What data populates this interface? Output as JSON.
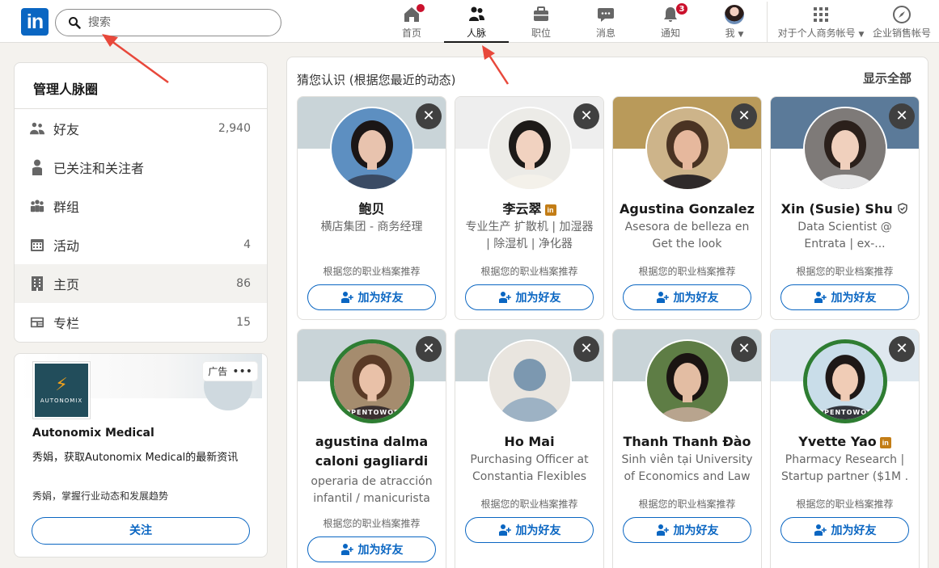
{
  "nav": {
    "logo_text": "in",
    "search": {
      "placeholder": "搜索"
    },
    "items": [
      {
        "label": "首页",
        "icon": "home-icon",
        "badge": ""
      },
      {
        "label": "人脉",
        "icon": "network-icon",
        "badge": ""
      },
      {
        "label": "职位",
        "icon": "briefcase-icon",
        "badge": ""
      },
      {
        "label": "消息",
        "icon": "messaging-icon",
        "badge": ""
      },
      {
        "label": "通知",
        "icon": "bell-icon",
        "badge": "3"
      },
      {
        "label": "我",
        "icon": "avatar",
        "badge": ""
      }
    ],
    "business": {
      "label": "对于个人商务帐号",
      "icon": "grid-icon"
    },
    "sales": {
      "label": "企业销售帐号",
      "icon": "compass-icon"
    }
  },
  "manage": {
    "title": "管理人脉圈",
    "items": [
      {
        "label": "好友",
        "count": "2,940",
        "icon": "people-icon"
      },
      {
        "label": "已关注和关注者",
        "count": "",
        "icon": "person-icon"
      },
      {
        "label": "群组",
        "count": "",
        "icon": "group-icon"
      },
      {
        "label": "活动",
        "count": "4",
        "icon": "calendar-icon"
      },
      {
        "label": "主页",
        "count": "86",
        "icon": "building-icon"
      },
      {
        "label": "专栏",
        "count": "15",
        "icon": "newsletter-icon"
      }
    ]
  },
  "ad": {
    "tag": "广告",
    "logo_text": "AUTONOMIX",
    "company": "Autonomix Medical",
    "desc": "秀娟，获取Autonomix Medical的最新资讯",
    "desc2": "秀娟，掌握行业动态和发展趋势",
    "follow": "关注"
  },
  "suggestions": {
    "title": "猜您认识 (根据您最近的动态)",
    "show_all": "显示全部",
    "reason": "根据您的职业档案推荐",
    "connect_label": "加为好友",
    "people": [
      {
        "name": "鲍贝",
        "headline": "横店集团 - 商务经理",
        "premium": false,
        "verified": false,
        "otw": false,
        "bg": "#c9d4d8",
        "skin": "#e8c3ae",
        "hair": "#1b1616",
        "shirt": "#3a4b64",
        "scene": "#5d8fc1"
      },
      {
        "name": "李云翠",
        "headline": "专业生产 扩散机 | 加湿器 | 除湿机 | 净化器",
        "premium": true,
        "verified": false,
        "otw": false,
        "bg": "#eeeeee",
        "skin": "#f1d2c0",
        "hair": "#1d1a18",
        "shirt": "#f4f1ea",
        "scene": "#ecebe7"
      },
      {
        "name": "Agustina Gonzalez",
        "headline": "Asesora de belleza en Get the look",
        "premium": false,
        "verified": false,
        "otw": false,
        "bg": "#b99a5a",
        "skin": "#e6b89d",
        "hair": "#4a3323",
        "shirt": "#2f2a2a",
        "scene": "#cdb48a"
      },
      {
        "name": "Xin (Susie) Shu",
        "headline": "Data Scientist @ Entrata | ex-...",
        "premium": false,
        "verified": true,
        "otw": false,
        "bg": "#5b7a99",
        "skin": "#f0d0bd",
        "hair": "#2b201b",
        "shirt": "#e9e9ea",
        "scene": "#7e7a78"
      },
      {
        "name": "agustina dalma caloni gagliardi",
        "headline": "operaria de atracción infantil / manicurista",
        "premium": false,
        "verified": false,
        "otw": true,
        "bg": "#c9d4d8",
        "skin": "#e9c1a8",
        "hair": "#5a3a26",
        "shirt": "#3b3030",
        "scene": "#a58c6e"
      },
      {
        "name": "Ho Mai",
        "headline": "Purchasing Officer at Constantia Flexibles",
        "premium": false,
        "verified": false,
        "otw": false,
        "bg": "#c9d4d8",
        "skin": "#9db2c4",
        "hair": "#9db2c4",
        "shirt": "#9db2c4",
        "scene": "#e9e5df"
      },
      {
        "name": "Thanh Thanh Đào",
        "headline": "Sinh viên tại University of Economics and Law",
        "premium": false,
        "verified": false,
        "otw": false,
        "bg": "#c9d4d8",
        "skin": "#e3bda3",
        "hair": "#1a1412",
        "shirt": "#b8a48e",
        "scene": "#5e7d45"
      },
      {
        "name": "Yvette Yao",
        "headline": "Pharmacy Research | Startup partner ($1M .",
        "premium": true,
        "verified": false,
        "otw": true,
        "bg": "#dfe8ef",
        "skin": "#f0ccb6",
        "hair": "#1e1817",
        "shirt": "#33353c",
        "scene": "#c9dde9"
      }
    ]
  }
}
